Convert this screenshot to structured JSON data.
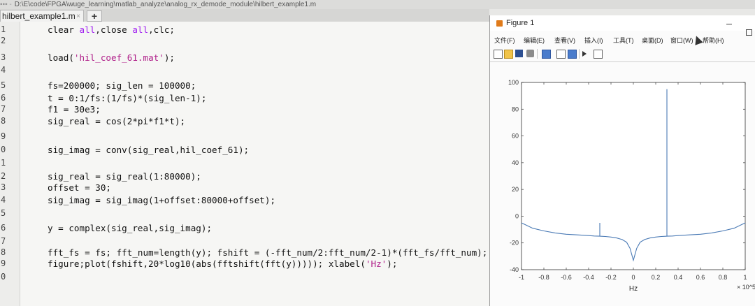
{
  "editor": {
    "title_path": "D:\\E\\code\\FPGA\\wuge_learning\\matlab_analyze\\analog_rx_demode_module\\hilbert_example1.m",
    "tab": {
      "label": "hilbert_example1.m",
      "close": "×",
      "add": "+"
    },
    "line_numbers": [
      "1",
      "2",
      "3",
      "4",
      "5",
      "6",
      "7",
      "8",
      "9",
      "0",
      "1",
      "2",
      "3",
      "4",
      "5",
      "6",
      "7",
      "8",
      "9",
      "0"
    ],
    "lines": [
      [
        {
          "t": "clear ",
          "c": ""
        },
        {
          "t": "all",
          "c": "kw"
        },
        {
          "t": ",",
          "c": ""
        },
        {
          "t": "close ",
          "c": ""
        },
        {
          "t": "all",
          "c": "kw"
        },
        {
          "t": ",clc;",
          "c": ""
        }
      ],
      [],
      [
        {
          "t": "load(",
          "c": ""
        },
        {
          "t": "'hil_coef_61.mat'",
          "c": "st"
        },
        {
          "t": ");",
          "c": ""
        }
      ],
      [],
      [
        {
          "t": "fs=200000; sig_len = 100000;",
          "c": ""
        }
      ],
      [
        {
          "t": "t = 0:1/fs:(1/fs)*(sig_len-1);",
          "c": ""
        }
      ],
      [
        {
          "t": "f1 = 30e3;",
          "c": ""
        }
      ],
      [
        {
          "t": "sig_real = cos(2*pi*f1*t);",
          "c": ""
        }
      ],
      [],
      [
        {
          "t": "sig_imag = conv(sig_real,hil_coef_61);",
          "c": ""
        }
      ],
      [],
      [
        {
          "t": "sig_real = sig_real(1:80000);",
          "c": ""
        }
      ],
      [
        {
          "t": "offset = 30;",
          "c": ""
        }
      ],
      [
        {
          "t": "sig_imag = sig_imag(1+offset:80000+offset);",
          "c": ""
        }
      ],
      [],
      [
        {
          "t": "y = complex(sig_real,sig_imag);",
          "c": ""
        }
      ],
      [],
      [
        {
          "t": "fft_fs = fs; fft_num=length(y); fshift = (-fft_num/2:fft_num/2-1)*(fft_fs/fft_num);",
          "c": ""
        }
      ],
      [
        {
          "t": "figure;plot(fshift,20*log10(abs(fftshift(fft(y))))); xlabel(",
          "c": ""
        },
        {
          "t": "'Hz'",
          "c": "st"
        },
        {
          "t": ");",
          "c": ""
        }
      ],
      []
    ]
  },
  "figure": {
    "title": "Figure 1",
    "menu": [
      "文件(F)",
      "编辑(E)",
      "查看(V)",
      "插入(I)",
      "工具(T)",
      "桌面(D)",
      "窗口(W)",
      "帮助(H)"
    ],
    "toolbar_icons": [
      "new-figure-icon",
      "open-file-icon",
      "save-icon",
      "print-icon",
      "link-icon",
      "insert-colorbar-icon",
      "insert-legend-icon",
      "pointer-icon",
      "property-inspector-icon"
    ]
  },
  "chart_data": {
    "type": "line",
    "title": "",
    "xlabel": "Hz",
    "ylabel": "",
    "x_exponent": "× 10^5",
    "xlim": [
      -1,
      1
    ],
    "ylim": [
      -40,
      100
    ],
    "xticks": [
      "-1",
      "-0.8",
      "-0.6",
      "-0.4",
      "-0.2",
      "0",
      "0.2",
      "0.4",
      "0.6",
      "0.8",
      "1"
    ],
    "yticks": [
      "-40",
      "-20",
      "0",
      "20",
      "40",
      "60",
      "80",
      "100"
    ],
    "grid": false,
    "series": [
      {
        "color": "#4a7ab5",
        "x": [
          -1,
          -0.9,
          -0.8,
          -0.7,
          -0.6,
          -0.5,
          -0.4,
          -0.35,
          -0.3,
          -0.3,
          -0.3,
          -0.25,
          -0.2,
          -0.15,
          -0.1,
          -0.06,
          -0.03,
          -0.01,
          0,
          0.01,
          0.03,
          0.06,
          0.1,
          0.15,
          0.2,
          0.25,
          0.3,
          0.3,
          0.3,
          0.35,
          0.4,
          0.5,
          0.6,
          0.7,
          0.8,
          0.9,
          1
        ],
        "y": [
          -5,
          -9,
          -11,
          -12.5,
          -13.5,
          -14,
          -14.5,
          -14.8,
          -15,
          -5,
          -15,
          -15.2,
          -15.6,
          -16.3,
          -17.5,
          -19.5,
          -24,
          -30,
          -33,
          -30,
          -24,
          -19.5,
          -17.5,
          -16.3,
          -15.6,
          -15.2,
          -15,
          95,
          -15,
          -14.8,
          -14.5,
          -14,
          -13.5,
          -12.5,
          -11,
          -9,
          -5
        ]
      }
    ]
  }
}
